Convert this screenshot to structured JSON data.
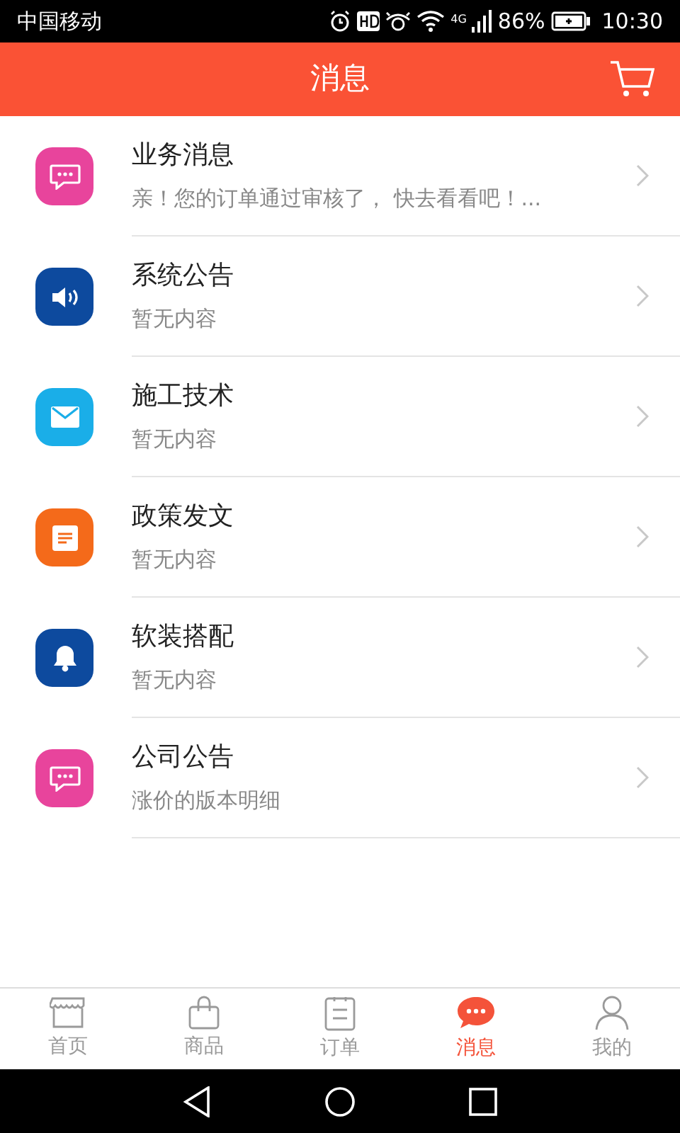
{
  "status_bar": {
    "carrier": "中国移动",
    "network": "4G",
    "battery": "86%",
    "time": "10:30"
  },
  "header": {
    "title": "消息"
  },
  "messages": [
    {
      "kind": "chat",
      "color": "#e8449c",
      "title": "业务消息",
      "preview": "亲！您的订单通过审核了， 快去看看吧！..."
    },
    {
      "kind": "speaker",
      "color": "#0d4a9e",
      "title": "系统公告",
      "preview": "暂无内容"
    },
    {
      "kind": "mail",
      "color": "#1aaee8",
      "title": "施工技术",
      "preview": "暂无内容"
    },
    {
      "kind": "note",
      "color": "#f46a1a",
      "title": "政策发文",
      "preview": "暂无内容"
    },
    {
      "kind": "bell",
      "color": "#0d4a9e",
      "title": "软装搭配",
      "preview": "暂无内容"
    },
    {
      "kind": "chat",
      "color": "#e8449c",
      "title": "公司公告",
      "preview": "涨价的版本明细"
    }
  ],
  "tab_bar": [
    {
      "kind": "store",
      "label": "首页",
      "selected": false
    },
    {
      "kind": "bag",
      "label": "商品",
      "selected": false
    },
    {
      "kind": "list",
      "label": "订单",
      "selected": false
    },
    {
      "kind": "chat",
      "label": "消息",
      "selected": true
    },
    {
      "kind": "person",
      "label": "我的",
      "selected": false
    }
  ]
}
